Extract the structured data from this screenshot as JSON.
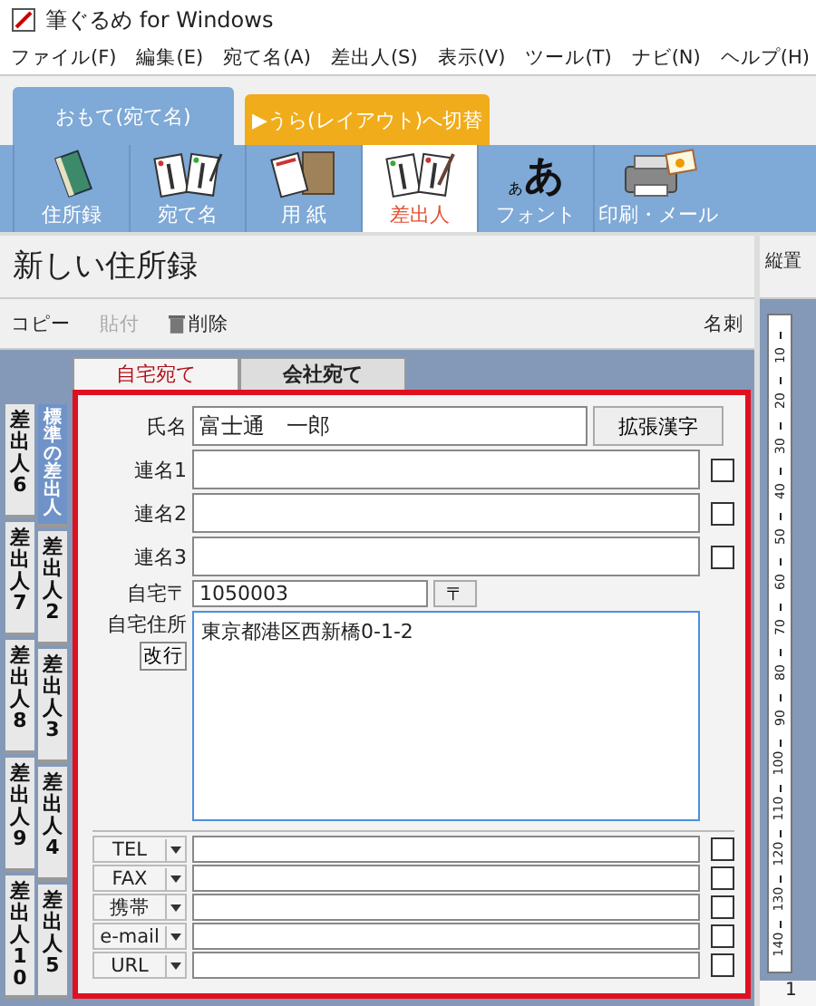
{
  "window": {
    "title": "筆ぐるめ for Windows"
  },
  "menu": [
    "ファイル(F)",
    "編集(E)",
    "宛て名(A)",
    "差出人(S)",
    "表示(V)",
    "ツール(T)",
    "ナビ(N)",
    "ヘルプ(H)"
  ],
  "mode_tabs": [
    {
      "label": "おもて(宛て名)",
      "selected": true
    },
    {
      "label": "▶うら(レイアウト)へ切替",
      "selected": false
    }
  ],
  "toolbar": [
    {
      "label": "住所録",
      "kind": "book",
      "selected": false
    },
    {
      "label": "宛て名",
      "kind": "cards",
      "selected": false
    },
    {
      "label": "用 紙",
      "kind": "paper",
      "selected": false
    },
    {
      "label": "差出人",
      "kind": "sender",
      "selected": true
    },
    {
      "label": "フォント",
      "kind": "font",
      "glyph_small": "ぁ",
      "glyph_large": "あ",
      "selected": false
    },
    {
      "label": "印刷・メール",
      "kind": "printer",
      "selected": false
    }
  ],
  "address_book": {
    "title": "新しい住所録",
    "actions": [
      {
        "label": "コピー",
        "kind": "plain",
        "disabled": false
      },
      {
        "label": "貼付",
        "kind": "plain",
        "disabled": true
      },
      {
        "label": "削除",
        "kind": "trash",
        "disabled": false
      }
    ],
    "card_label": "名刺"
  },
  "sender_tabs": [
    [
      {
        "label": "差出人6",
        "selected": false
      },
      {
        "label": "差出人7",
        "selected": false
      },
      {
        "label": "差出人8",
        "selected": false
      },
      {
        "label": "差出人9",
        "selected": false
      },
      {
        "label": "差出人10",
        "selected": false
      }
    ],
    [
      {
        "label": "標準の差出人",
        "selected": true
      },
      {
        "label": "差出人2",
        "selected": false
      },
      {
        "label": "差出人3",
        "selected": false
      },
      {
        "label": "差出人4",
        "selected": false
      },
      {
        "label": "差出人5",
        "selected": false
      }
    ]
  ],
  "form_tabs": [
    {
      "label": "自宅宛て",
      "selected": true
    },
    {
      "label": "会社宛て",
      "selected": false
    }
  ],
  "form": {
    "name": {
      "label": "氏名",
      "value": "富士通　一郎",
      "button": "拡張漢字"
    },
    "joint_names": [
      {
        "label": "連名1",
        "checked": false
      },
      {
        "label": "連名2",
        "checked": false
      },
      {
        "label": "連名3",
        "checked": false
      }
    ],
    "postal": {
      "label": "自宅〒",
      "value": "1050003",
      "button": "〒"
    },
    "address": {
      "label": "自宅住所",
      "button": "改行",
      "value": "東京都港区西新橋0-1-2"
    },
    "contacts": [
      {
        "type": "TEL",
        "checked": false
      },
      {
        "type": "FAX",
        "checked": false
      },
      {
        "type": "携帯",
        "checked": false
      },
      {
        "type": "e-mail",
        "checked": false
      },
      {
        "type": "URL",
        "checked": false
      }
    ]
  },
  "side_panel": {
    "title": "縦置",
    "ruler": [
      "10",
      "20",
      "30",
      "40",
      "50",
      "60",
      "70",
      "80",
      "90",
      "100",
      "110",
      "120",
      "130",
      "140"
    ],
    "page": "1"
  }
}
